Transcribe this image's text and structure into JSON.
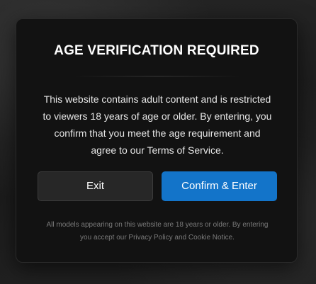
{
  "modal": {
    "title": "AGE VERIFICATION REQUIRED",
    "message": "This website contains adult content and is restricted to viewers 18 years of age or older. By entering, you confirm that you meet the age requirement and agree to our Terms of Service.",
    "exit_label": "Exit",
    "confirm_label": "Confirm & Enter",
    "footnote": "All models appearing on this website are 18 years or older. By entering you accept our Privacy Policy and Cookie Notice.",
    "accent_color": "#1374c9"
  }
}
